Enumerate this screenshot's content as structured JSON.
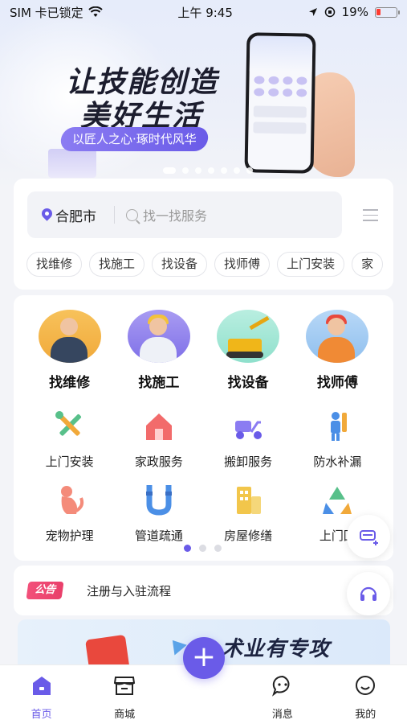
{
  "status_bar": {
    "carrier": "SIM 卡已锁定",
    "time": "上午 9:45",
    "battery": "19%",
    "battery_color": "#ff3b30"
  },
  "banner": {
    "title_line1": "让技能创造",
    "title_line2": "美好生活",
    "slogan": "以匠人之心·琢时代风华",
    "dot_count": 7,
    "active_dot": 0
  },
  "search": {
    "city": "合肥市",
    "placeholder": "找一找服务",
    "chips": [
      "找维修",
      "找施工",
      "找设备",
      "找师傅",
      "上门安装",
      "家"
    ]
  },
  "categories": {
    "featured": [
      {
        "label": "找维修",
        "icon": "repairman-avatar"
      },
      {
        "label": "找施工",
        "icon": "construction-workers-avatar"
      },
      {
        "label": "找设备",
        "icon": "excavator-avatar"
      },
      {
        "label": "找师傅",
        "icon": "master-worker-avatar"
      }
    ],
    "row2": [
      {
        "label": "上门安装",
        "icon": "tools-icon"
      },
      {
        "label": "家政服务",
        "icon": "house-icon"
      },
      {
        "label": "搬卸服务",
        "icon": "delivery-scooter-icon"
      },
      {
        "label": "防水补漏",
        "icon": "waterproof-icon"
      }
    ],
    "row3": [
      {
        "label": "宠物护理",
        "icon": "pet-icon"
      },
      {
        "label": "管道疏通",
        "icon": "pipe-icon"
      },
      {
        "label": "房屋修缮",
        "icon": "building-icon"
      },
      {
        "label": "上门回",
        "icon": "recycle-icon"
      }
    ],
    "page_count": 3,
    "active_page": 0
  },
  "notice": {
    "badge": "公告",
    "text": "注册与入驻流程"
  },
  "promo": {
    "text": "术业有专攻"
  },
  "tabbar": {
    "items": [
      {
        "label": "首页",
        "icon": "home-icon",
        "active": true
      },
      {
        "label": "商城",
        "icon": "store-icon",
        "active": false
      },
      {
        "label": "消息",
        "icon": "message-icon",
        "active": false
      },
      {
        "label": "我的",
        "icon": "profile-icon",
        "active": false
      }
    ],
    "add_label": "+"
  },
  "colors": {
    "accent": "#6a5be8",
    "notice_badge": "#ee4874"
  }
}
